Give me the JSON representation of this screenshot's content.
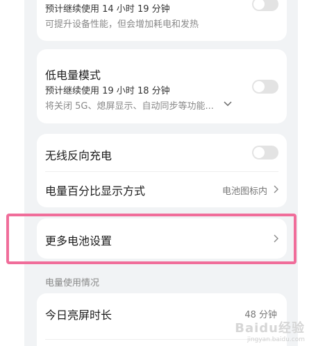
{
  "high_perf": {
    "sub": "预计继续使用 14 小时 19 分钟",
    "desc": "可提升设备性能，但会增加耗电和发热"
  },
  "low_power": {
    "title": "低电量模式",
    "sub": "预计继续使用 19 小时 18 分钟",
    "desc": "将关闭 5G、熄屏显示、自动同步等功能..."
  },
  "reverse_charge": {
    "title": "无线反向充电"
  },
  "battery_percent": {
    "title": "电量百分比显示方式",
    "value": "电池图标内"
  },
  "more_battery": {
    "title": "更多电池设置"
  },
  "usage_section": {
    "label": "电量使用情况"
  },
  "screen_time": {
    "title": "今日亮屏时长",
    "value": "48 分钟"
  },
  "watermark": {
    "brand": "Baidu经验",
    "url": "jingyan.baidu.com"
  }
}
